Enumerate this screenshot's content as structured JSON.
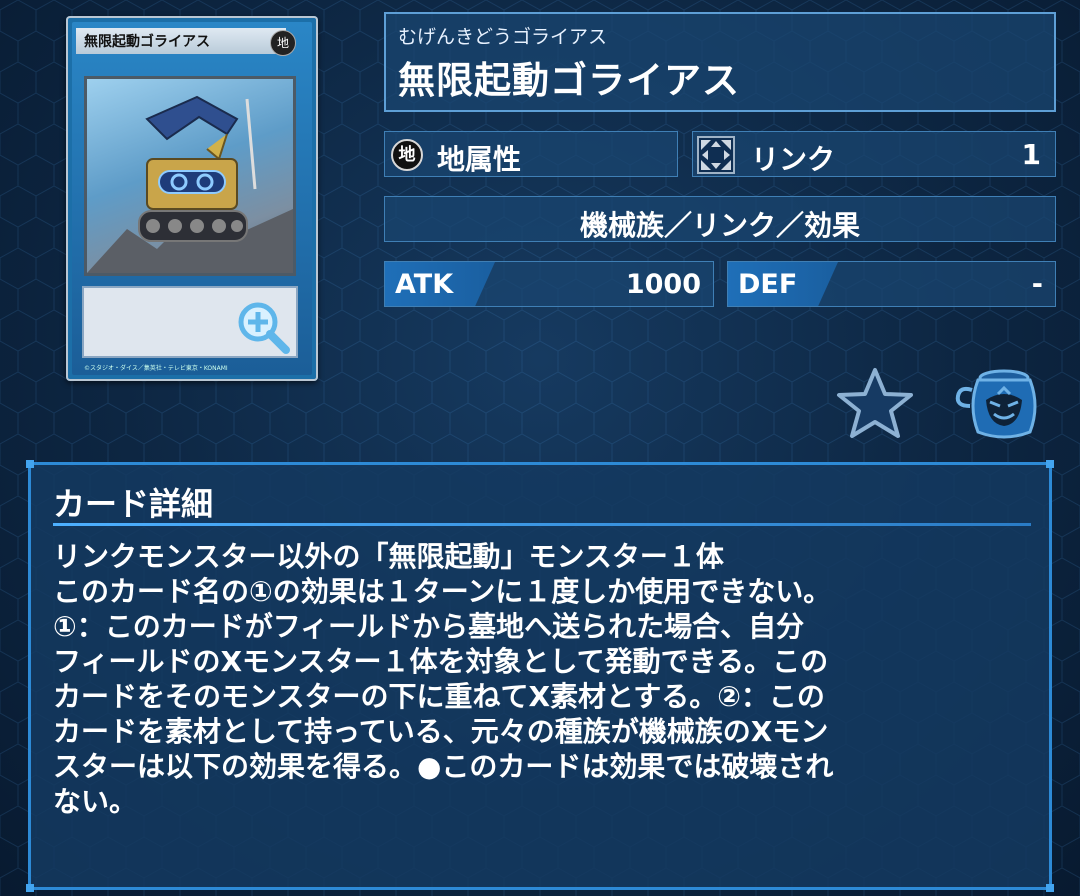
{
  "card": {
    "card_name": "無限起動ゴライアス",
    "attribute_badge": "地",
    "copyright": "©スタジオ・ダイス／集英社・テレビ東京・KONAMI"
  },
  "name_panel": {
    "reading": "むげんきどうゴライアス",
    "name": "無限起動ゴライアス"
  },
  "attribute": {
    "icon_char": "地",
    "label": "地属性"
  },
  "link": {
    "label": "リンク",
    "value": "1"
  },
  "type_line": "機械族／リンク／効果",
  "atk": {
    "label": "ATK",
    "value": "1000"
  },
  "def": {
    "label": "DEF",
    "value": "-"
  },
  "detail": {
    "title": "カード詳細",
    "text": "リンクモンスター以外の「無限起動」モンスター１体\nこのカード名の①の効果は１ターンに１度しか使用できない。\n①：このカードがフィールドから墓地へ送られた場合、自分\nフィールドのXモンスター１体を対象として発動できる。この\nカードをそのモンスターの下に重ねてX素材とする。②：この\nカードを素材として持っている、元々の種族が機械族のXモン\nスターは以下の効果を得る。●このカードは効果では破壊され\nない。"
  },
  "colors": {
    "background": "#0d2642",
    "panel": "#194670",
    "accent": "#2d8ad6",
    "card_frame": "#1c6fa8"
  },
  "icons": [
    "zoom-icon",
    "star-icon",
    "pot-icon",
    "link-arrows-icon",
    "earth-attribute-icon"
  ]
}
